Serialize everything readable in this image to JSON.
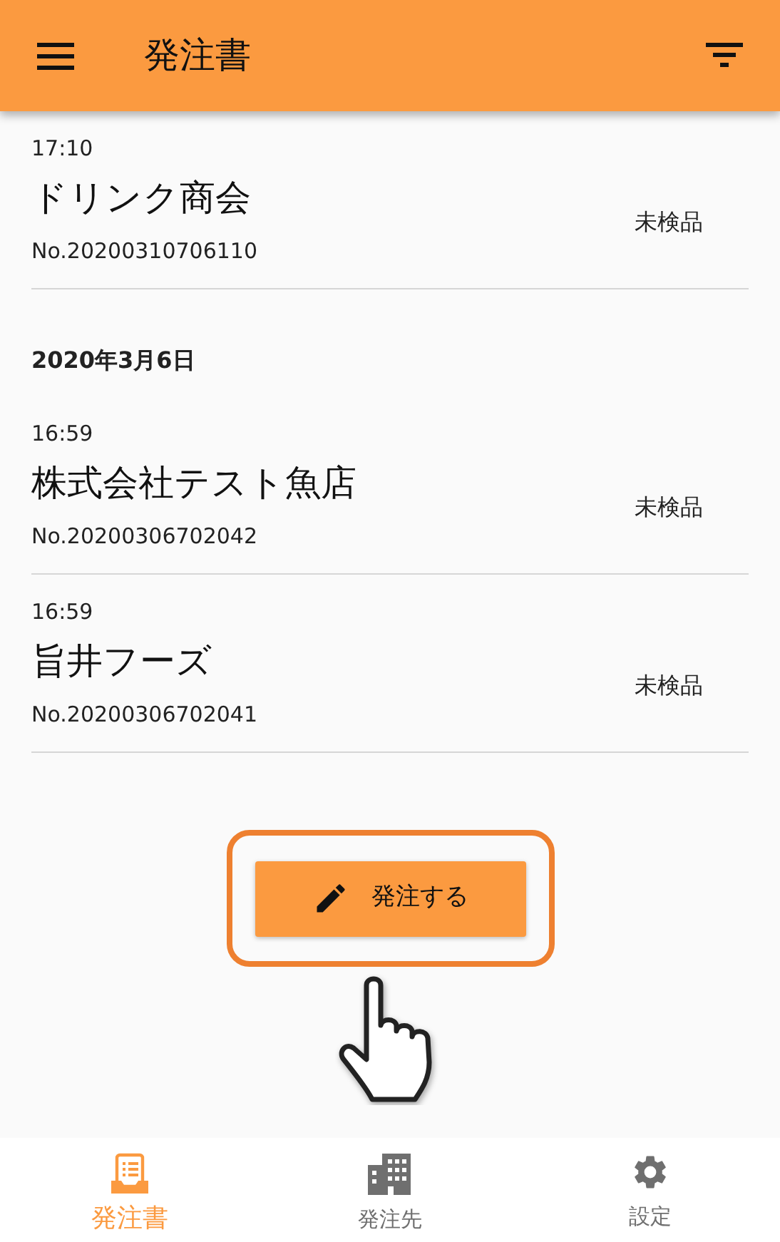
{
  "app_bar": {
    "title": "発注書"
  },
  "entries": [
    {
      "kind": "order",
      "time": "17:10",
      "name": "ドリンク商会",
      "number": "No.20200310706110",
      "status": "未検品"
    },
    {
      "kind": "date",
      "label": "2020年3月6日"
    },
    {
      "kind": "order",
      "time": "16:59",
      "name": "株式会社テスト魚店",
      "number": "No.20200306702042",
      "status": "未検品"
    },
    {
      "kind": "order",
      "time": "16:59",
      "name": "旨井フーズ",
      "number": "No.20200306702041",
      "status": "未検品"
    }
  ],
  "order_button": {
    "label": "発注する",
    "highlighted": true
  },
  "bottom_nav": [
    {
      "kind": "orders",
      "label": "発注書",
      "selected": true
    },
    {
      "kind": "suppliers",
      "label": "発注先",
      "selected": false
    },
    {
      "kind": "settings",
      "label": "設定",
      "selected": false
    }
  ]
}
